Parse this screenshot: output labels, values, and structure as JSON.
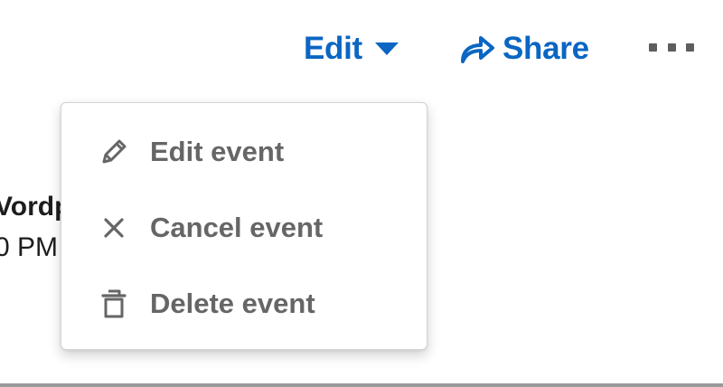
{
  "toolbar": {
    "edit_label": "Edit",
    "share_label": "Share",
    "accent_color": "#0a66c2"
  },
  "background_event": {
    "name_fragment": "Vordp",
    "time_fragment": "0 PM"
  },
  "dropdown": {
    "items": [
      {
        "label": "Edit event",
        "icon": "pencil-icon"
      },
      {
        "label": "Cancel event",
        "icon": "close-icon"
      },
      {
        "label": "Delete event",
        "icon": "trash-icon"
      }
    ]
  }
}
